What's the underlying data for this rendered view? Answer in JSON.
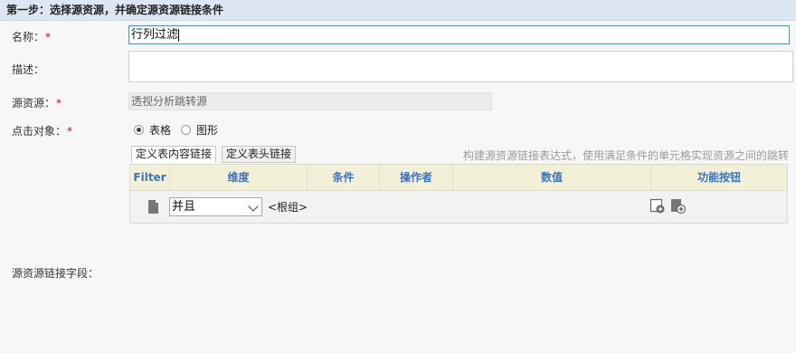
{
  "header": {
    "title": "第一步：选择源资源，并确定源资源链接条件"
  },
  "form": {
    "name": {
      "label": "名称：",
      "required": "*",
      "value": "行列过滤"
    },
    "description": {
      "label": "描述：",
      "value": ""
    },
    "source": {
      "label": "源资源：",
      "required": "*",
      "value": "透视分析跳转源"
    },
    "click_target": {
      "label": "点击对象：",
      "required": "*",
      "options": [
        {
          "label": "表格",
          "checked": true
        },
        {
          "label": "图形",
          "checked": false
        }
      ]
    },
    "link_field": {
      "label": "源资源链接字段："
    }
  },
  "tabs": [
    {
      "label": "定义表内容链接",
      "active": true
    },
    {
      "label": "定义表头链接",
      "active": false
    }
  ],
  "hint": "构建源资源链接表达式，使用满足条件的单元格实现资源之间的跳转",
  "grid": {
    "columns": [
      "Filter",
      "维度",
      "条件",
      "操作者",
      "数值",
      "功能按钮"
    ],
    "row": {
      "operator_select": "并且",
      "group_label": "<根组>"
    }
  },
  "colors": {
    "header_bg": "#dce7f3",
    "grid_header_bg": "#f3f0d8",
    "column_text": "#3b74c2",
    "required": "#e0001b"
  }
}
